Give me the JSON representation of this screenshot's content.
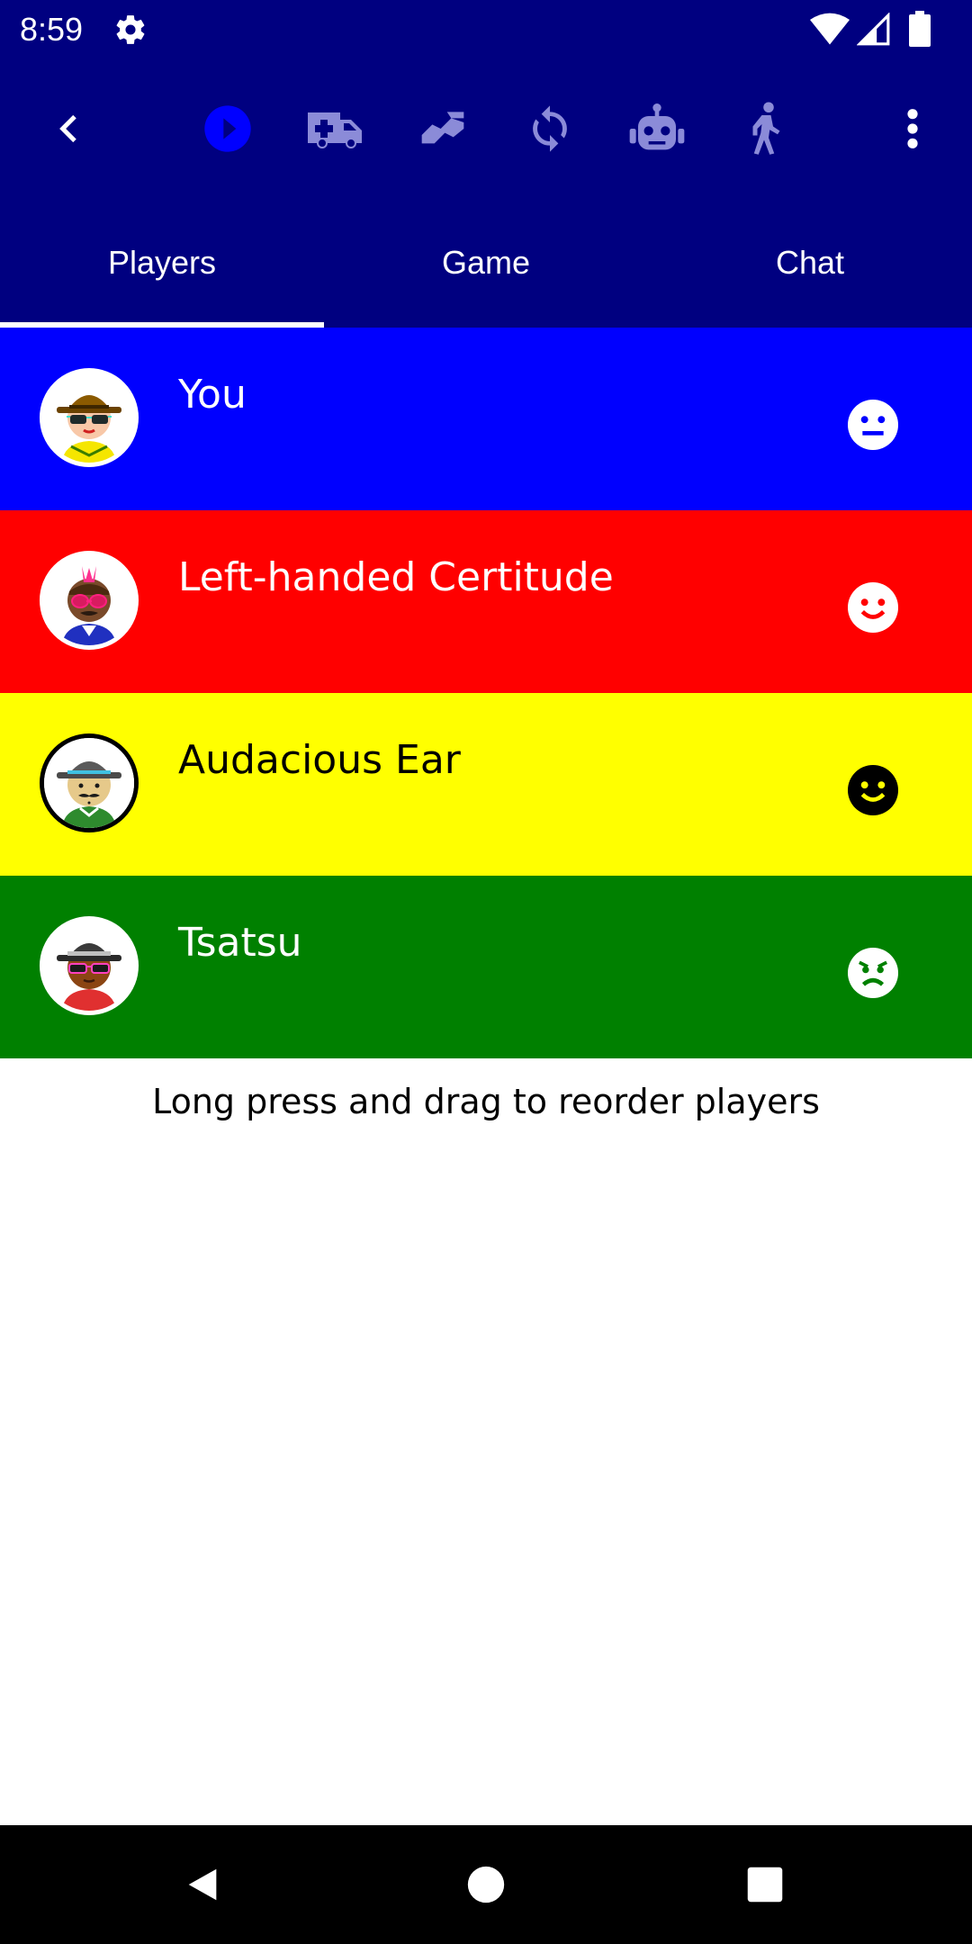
{
  "status_bar": {
    "time": "8:59",
    "settings_icon": "gear-icon",
    "wifi_icon": "wifi-icon",
    "signal_icon": "signal-icon",
    "battery_icon": "battery-icon"
  },
  "toolbar": {
    "back_icon": "arrow-back-icon",
    "actions": [
      {
        "icon": "play-circle-icon",
        "state": "active",
        "color": "#0000ff"
      },
      {
        "icon": "ambulance-icon",
        "state": "inactive",
        "color": "#8b8bd8"
      },
      {
        "icon": "handshake-icon",
        "state": "inactive",
        "color": "#8b8bd8"
      },
      {
        "icon": "sync-icon",
        "state": "inactive",
        "color": "#8b8bd8"
      },
      {
        "icon": "robot-icon",
        "state": "inactive",
        "color": "#8b8bd8"
      },
      {
        "icon": "walking-icon",
        "state": "inactive",
        "color": "#8b8bd8"
      }
    ],
    "overflow_icon": "more-vertical-icon"
  },
  "tabs": [
    {
      "label": "Players",
      "selected": true
    },
    {
      "label": "Game",
      "selected": false
    },
    {
      "label": "Chat",
      "selected": false
    }
  ],
  "players": [
    {
      "name": "You",
      "row_color": "#0000ff",
      "text_color": "#ffffff",
      "mood": "neutral-face-icon",
      "avatar": "avatar-fedora-sunglasses"
    },
    {
      "name": "Left-handed Certitude",
      "row_color": "#ff0000",
      "text_color": "#ffffff",
      "mood": "smile-face-icon",
      "avatar": "avatar-mohawk-pink-glasses"
    },
    {
      "name": "Audacious Ear",
      "row_color": "#ffff00",
      "text_color": "#000000",
      "mood": "smile-face-icon",
      "avatar": "avatar-hat-mustache"
    },
    {
      "name": "Tsatsu",
      "row_color": "#008000",
      "text_color": "#ffffff",
      "mood": "frown-face-icon",
      "avatar": "avatar-fedora-pink-glasses"
    }
  ],
  "hint": "Long press and drag to reorder players",
  "navigation_bar": {
    "back": "nav-back-icon",
    "home": "nav-home-icon",
    "recents": "nav-recents-icon"
  },
  "colors": {
    "app_bar": "#000080",
    "nav_bar": "#000000"
  }
}
